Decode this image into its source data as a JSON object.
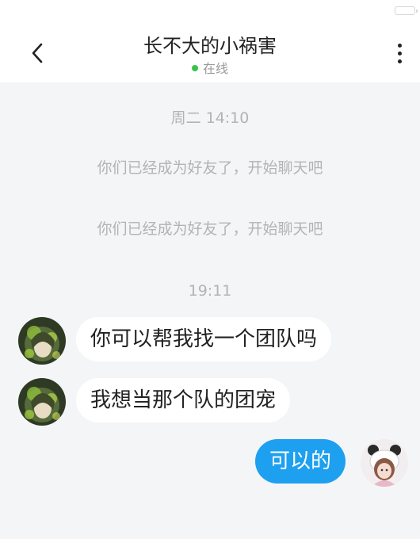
{
  "header": {
    "title": "长不大的小祸害",
    "status": "在线",
    "status_color": "#3ac249",
    "back_icon": "chevron-left-icon",
    "more_icon": "more-vertical-icon"
  },
  "messages": {
    "time1": "周二 14:10",
    "system1": "你们已经成为好友了，开始聊天吧",
    "system2": "你们已经成为好友了，开始聊天吧",
    "time2": "19:11",
    "incoming1": "你可以帮我找一个团队吗",
    "incoming2": "我想当那个队的团宠",
    "outgoing1": "可以的"
  },
  "colors": {
    "outgoing_bubble": "#1ea0f0",
    "incoming_bubble": "#ffffff",
    "background": "#f4f5f7"
  }
}
